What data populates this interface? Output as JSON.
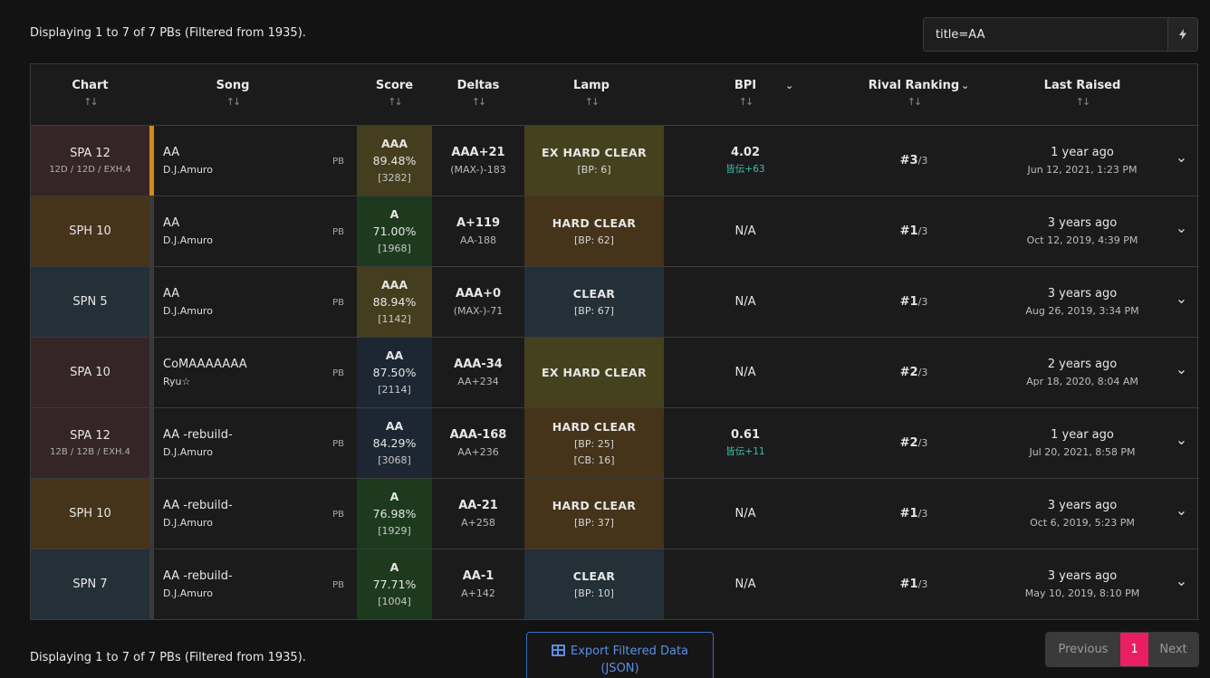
{
  "status_text": "Displaying 1 to 7 of 7 PBs (Filtered from 1935).",
  "search": {
    "value": "title=AA",
    "button_icon": "bolt-icon"
  },
  "headers": {
    "chart": "Chart",
    "song": "Song",
    "score": "Score",
    "deltas": "Deltas",
    "lamp": "Lamp",
    "bpi": "BPI",
    "rival": "Rival Ranking",
    "raised": "Last Raised",
    "sort_glyph": "↑↓",
    "chevron_glyph": "⌄"
  },
  "rows": [
    {
      "chart": "SPA 12",
      "chart_sub": "12D / 12D / EXH.4",
      "song": "AA",
      "artist": "D.J.Amuro",
      "pb": "PB",
      "grade": "AAA",
      "percent": "89.48%",
      "ex": "[3282]",
      "delta": "AAA+21",
      "delta_sub": "(MAX-)-183",
      "lamp": "EX HARD CLEAR",
      "lamp_sub": "[BP: 6]",
      "lamp_sub2": "",
      "bpi": "4.02",
      "bpi_sub": "皆伝+63",
      "rank": "#3",
      "rank_total": "/3",
      "raised": "1 year ago",
      "raised_date": "Jun 12, 2021, 1:23 PM",
      "expand": "⌄",
      "colors": {
        "chart": "#352526",
        "accent": "#d4891a",
        "score": "#443e1e",
        "lamp": "#45411e"
      }
    },
    {
      "chart": "SPH 10",
      "chart_sub": "",
      "song": "AA",
      "artist": "D.J.Amuro",
      "pb": "PB",
      "grade": "A",
      "percent": "71.00%",
      "ex": "[1968]",
      "delta": "A+119",
      "delta_sub": "AA-188",
      "lamp": "HARD CLEAR",
      "lamp_sub": "[BP: 62]",
      "lamp_sub2": "",
      "bpi": "N/A",
      "bpi_sub": "",
      "rank": "#1",
      "rank_total": "/3",
      "raised": "3 years ago",
      "raised_date": "Oct 12, 2019, 4:39 PM",
      "expand": "⌄",
      "colors": {
        "chart": "#45331a",
        "accent": "#3a3a3a",
        "score": "#1d3a1e",
        "lamp": "#45331a"
      }
    },
    {
      "chart": "SPN 5",
      "chart_sub": "",
      "song": "AA",
      "artist": "D.J.Amuro",
      "pb": "PB",
      "grade": "AAA",
      "percent": "88.94%",
      "ex": "[1142]",
      "delta": "AAA+0",
      "delta_sub": "(MAX-)-71",
      "lamp": "CLEAR",
      "lamp_sub": "[BP: 67]",
      "lamp_sub2": "",
      "bpi": "N/A",
      "bpi_sub": "",
      "rank": "#1",
      "rank_total": "/3",
      "raised": "3 years ago",
      "raised_date": "Aug 26, 2019, 3:34 PM",
      "expand": "⌄",
      "colors": {
        "chart": "#243038",
        "accent": "#3a3a3a",
        "score": "#443e1e",
        "lamp": "#243038"
      }
    },
    {
      "chart": "SPA 10",
      "chart_sub": "",
      "song": "CoMAAAAAAA",
      "artist": "Ryu☆",
      "pb": "PB",
      "grade": "AA",
      "percent": "87.50%",
      "ex": "[2114]",
      "delta": "AAA-34",
      "delta_sub": "AA+234",
      "lamp": "EX HARD CLEAR",
      "lamp_sub": "",
      "lamp_sub2": "",
      "bpi": "N/A",
      "bpi_sub": "",
      "rank": "#2",
      "rank_total": "/3",
      "raised": "2 years ago",
      "raised_date": "Apr 18, 2020, 8:04 AM",
      "expand": "⌄",
      "colors": {
        "chart": "#352526",
        "accent": "#3a3a3a",
        "score": "#1c2733",
        "lamp": "#45411e"
      }
    },
    {
      "chart": "SPA 12",
      "chart_sub": "12B / 12B / EXH.4",
      "song": "AA -rebuild-",
      "artist": "D.J.Amuro",
      "pb": "PB",
      "grade": "AA",
      "percent": "84.29%",
      "ex": "[3068]",
      "delta": "AAA-168",
      "delta_sub": "AA+236",
      "lamp": "HARD CLEAR",
      "lamp_sub": "[BP: 25]",
      "lamp_sub2": "[CB: 16]",
      "bpi": "0.61",
      "bpi_sub": "皆伝+11",
      "rank": "#2",
      "rank_total": "/3",
      "raised": "1 year ago",
      "raised_date": "Jul 20, 2021, 8:58 PM",
      "expand": "⌄",
      "colors": {
        "chart": "#352526",
        "accent": "#3a3a3a",
        "score": "#1c2733",
        "lamp": "#45331a"
      }
    },
    {
      "chart": "SPH 10",
      "chart_sub": "",
      "song": "AA -rebuild-",
      "artist": "D.J.Amuro",
      "pb": "PB",
      "grade": "A",
      "percent": "76.98%",
      "ex": "[1929]",
      "delta": "AA-21",
      "delta_sub": "A+258",
      "lamp": "HARD CLEAR",
      "lamp_sub": "[BP: 37]",
      "lamp_sub2": "",
      "bpi": "N/A",
      "bpi_sub": "",
      "rank": "#1",
      "rank_total": "/3",
      "raised": "3 years ago",
      "raised_date": "Oct 6, 2019, 5:23 PM",
      "expand": "⌄",
      "colors": {
        "chart": "#45331a",
        "accent": "#3a3a3a",
        "score": "#1d3a1e",
        "lamp": "#45331a"
      }
    },
    {
      "chart": "SPN 7",
      "chart_sub": "",
      "song": "AA -rebuild-",
      "artist": "D.J.Amuro",
      "pb": "PB",
      "grade": "A",
      "percent": "77.71%",
      "ex": "[1004]",
      "delta": "AA-1",
      "delta_sub": "A+142",
      "lamp": "CLEAR",
      "lamp_sub": "[BP: 10]",
      "lamp_sub2": "",
      "bpi": "N/A",
      "bpi_sub": "",
      "rank": "#1",
      "rank_total": "/3",
      "raised": "3 years ago",
      "raised_date": "May 10, 2019, 8:10 PM",
      "expand": "⌄",
      "colors": {
        "chart": "#243038",
        "accent": "#3a3a3a",
        "score": "#1d3a1e",
        "lamp": "#243038"
      }
    }
  ],
  "export_button": {
    "label_line1": "Export Filtered Data",
    "label_line2": "(JSON)",
    "icon": "table-icon"
  },
  "pagination": {
    "previous": "Previous",
    "current": "1",
    "next": "Next"
  }
}
